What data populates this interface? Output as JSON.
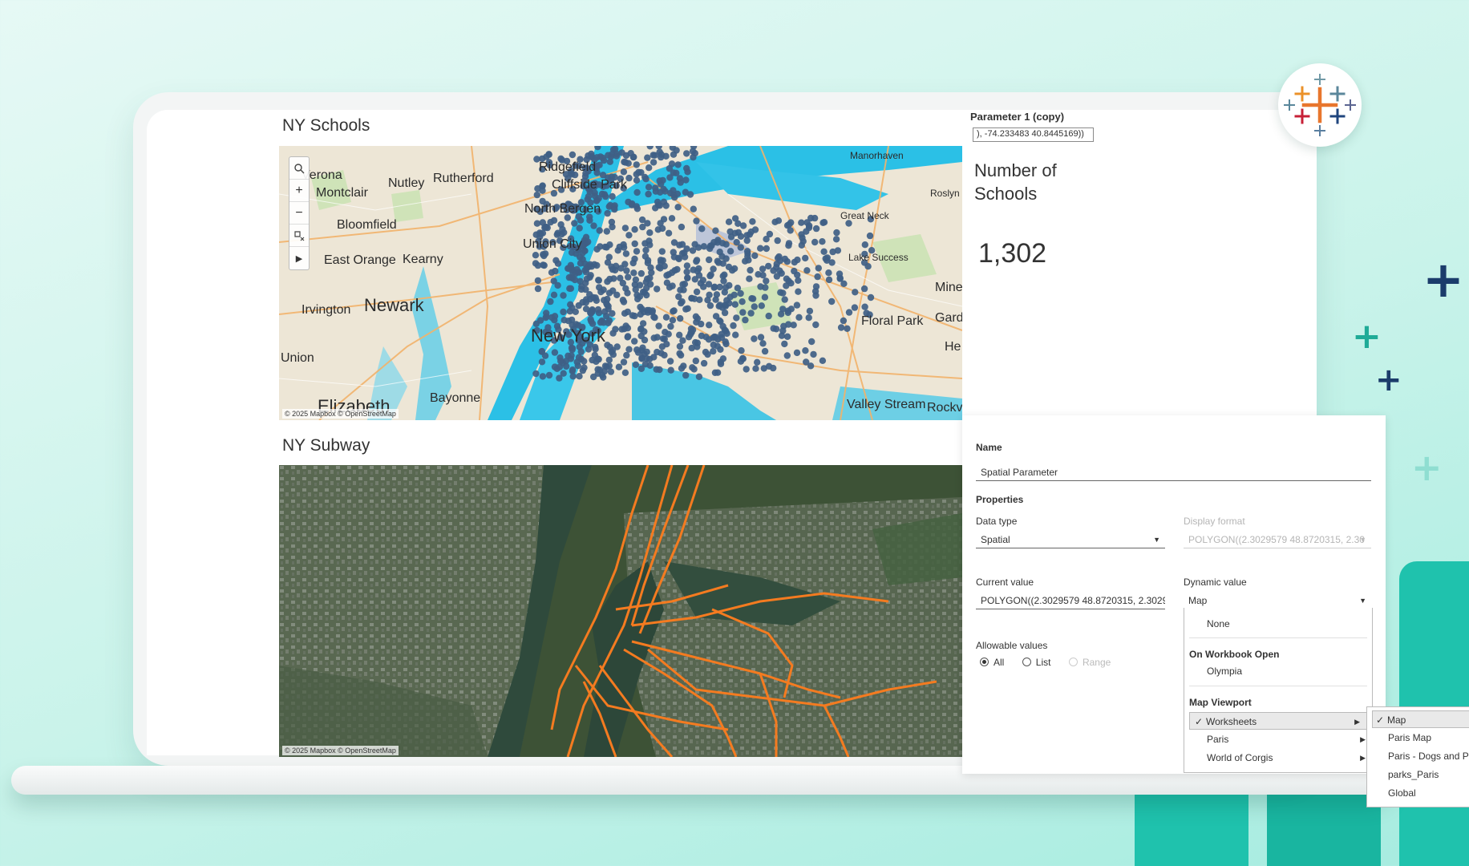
{
  "dashboard": {
    "schools_title": "NY Schools",
    "subway_title": "NY Subway",
    "parameter": {
      "title": "Parameter 1 (copy)",
      "value": "), -74.233483 40.8445169))"
    },
    "kpi": {
      "label": "Number of Schools",
      "value": "1,302"
    },
    "map_credit": "© 2025 Mapbox © OpenStreetMap",
    "schools_map_labels": [
      "Verona",
      "Nutley",
      "Rutherford",
      "Ridgefield",
      "Cliffside Park",
      "Montclair",
      "North Bergen",
      "Bloomfield",
      "Union City",
      "East Orange",
      "Kearny",
      "Newark",
      "Irvington",
      "New York",
      "Union",
      "Elizabeth",
      "Bayonne",
      "Manorhaven",
      "Roslyn",
      "Great Neck",
      "Lake Success",
      "Mine",
      "Floral Park",
      "Garde",
      "He",
      "Valley Stream",
      "Rockvi"
    ],
    "subway_colors": {
      "line": "#f47b20"
    },
    "school_dot_color": "#3f5f86"
  },
  "dialog": {
    "name_label": "Name",
    "name_value": "Spatial Parameter",
    "properties_label": "Properties",
    "data_type_label": "Data type",
    "data_type_value": "Spatial",
    "display_format_label": "Display format",
    "display_format_value": "POLYGON((2.3029579 48.8720315, 2.30",
    "current_value_label": "Current value",
    "current_value_value": "POLYGON((2.3029579 48.8720315, 2.3029",
    "dynamic_value_label": "Dynamic value",
    "dynamic_value_value": "Map",
    "allowable_label": "Allowable values",
    "allowable_options": [
      "All",
      "List",
      "Range"
    ]
  },
  "dropdown": {
    "none": "None",
    "on_open_header": "On Workbook Open",
    "olympia": "Olympia",
    "viewport_header": "Map Viewport",
    "worksheets": "Worksheets",
    "paris": "Paris",
    "corgis": "World of Corgis"
  },
  "submenu": {
    "items": [
      "Map",
      "Paris Map",
      "Paris - Dogs and Pa",
      "parks_Paris",
      "Global"
    ]
  },
  "brand": {
    "teal": "#1fc2ad",
    "navy": "#1b3c6b"
  }
}
